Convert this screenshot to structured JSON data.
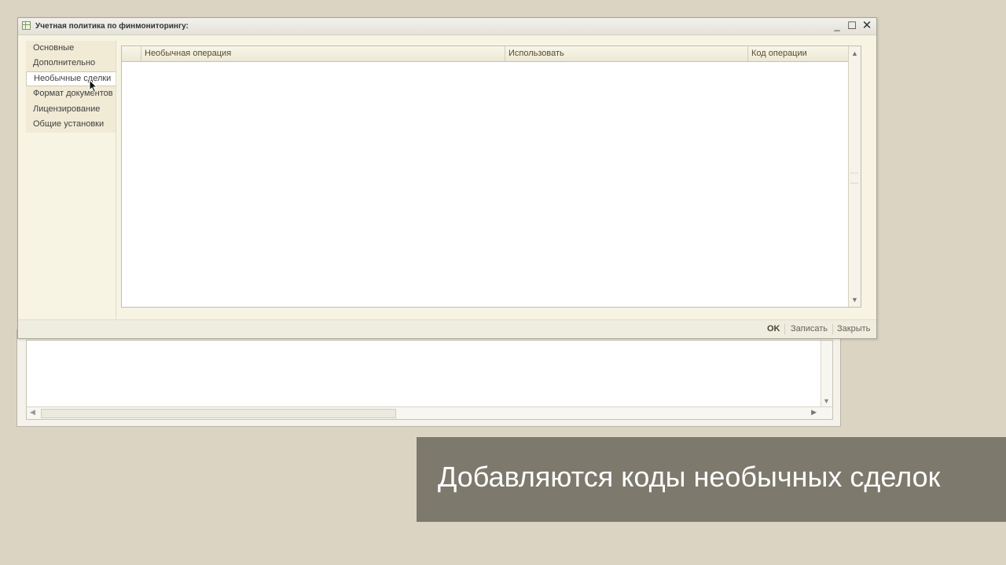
{
  "dialog": {
    "title": "Учетная политика по финмониторингу:",
    "window_controls": {
      "minimize": "_",
      "maximize": "☐",
      "close": "✕"
    }
  },
  "nav": {
    "items": [
      {
        "label": "Основные",
        "active": false
      },
      {
        "label": "Дополнительно",
        "active": false
      },
      {
        "label": "Необычные сделки",
        "active": true
      },
      {
        "label": "Формат документов",
        "active": false
      },
      {
        "label": "Лицензирование",
        "active": false
      },
      {
        "label": "Общие установки",
        "active": false
      }
    ]
  },
  "table": {
    "columns": [
      "Необычная операция",
      "Использовать",
      "Код операции"
    ],
    "rows": []
  },
  "footer": {
    "ok": "OK",
    "save": "Записать",
    "close": "Закрыть"
  },
  "caption": {
    "text": "Добавляются коды необычных сделок"
  },
  "colors": {
    "background": "#dbd4c3",
    "dialog_bg": "#f7f4e4",
    "caption_bg": "#7d796d",
    "caption_text": "#ffffff",
    "header_text": "#5a4a2a"
  },
  "icons": {
    "window": "table-grid-icon",
    "scroll_up": "arrow-up-icon",
    "scroll_down": "arrow-down-icon",
    "scroll_left": "arrow-left-icon",
    "scroll_right": "arrow-right-icon",
    "cursor": "mouse-pointer-icon"
  }
}
